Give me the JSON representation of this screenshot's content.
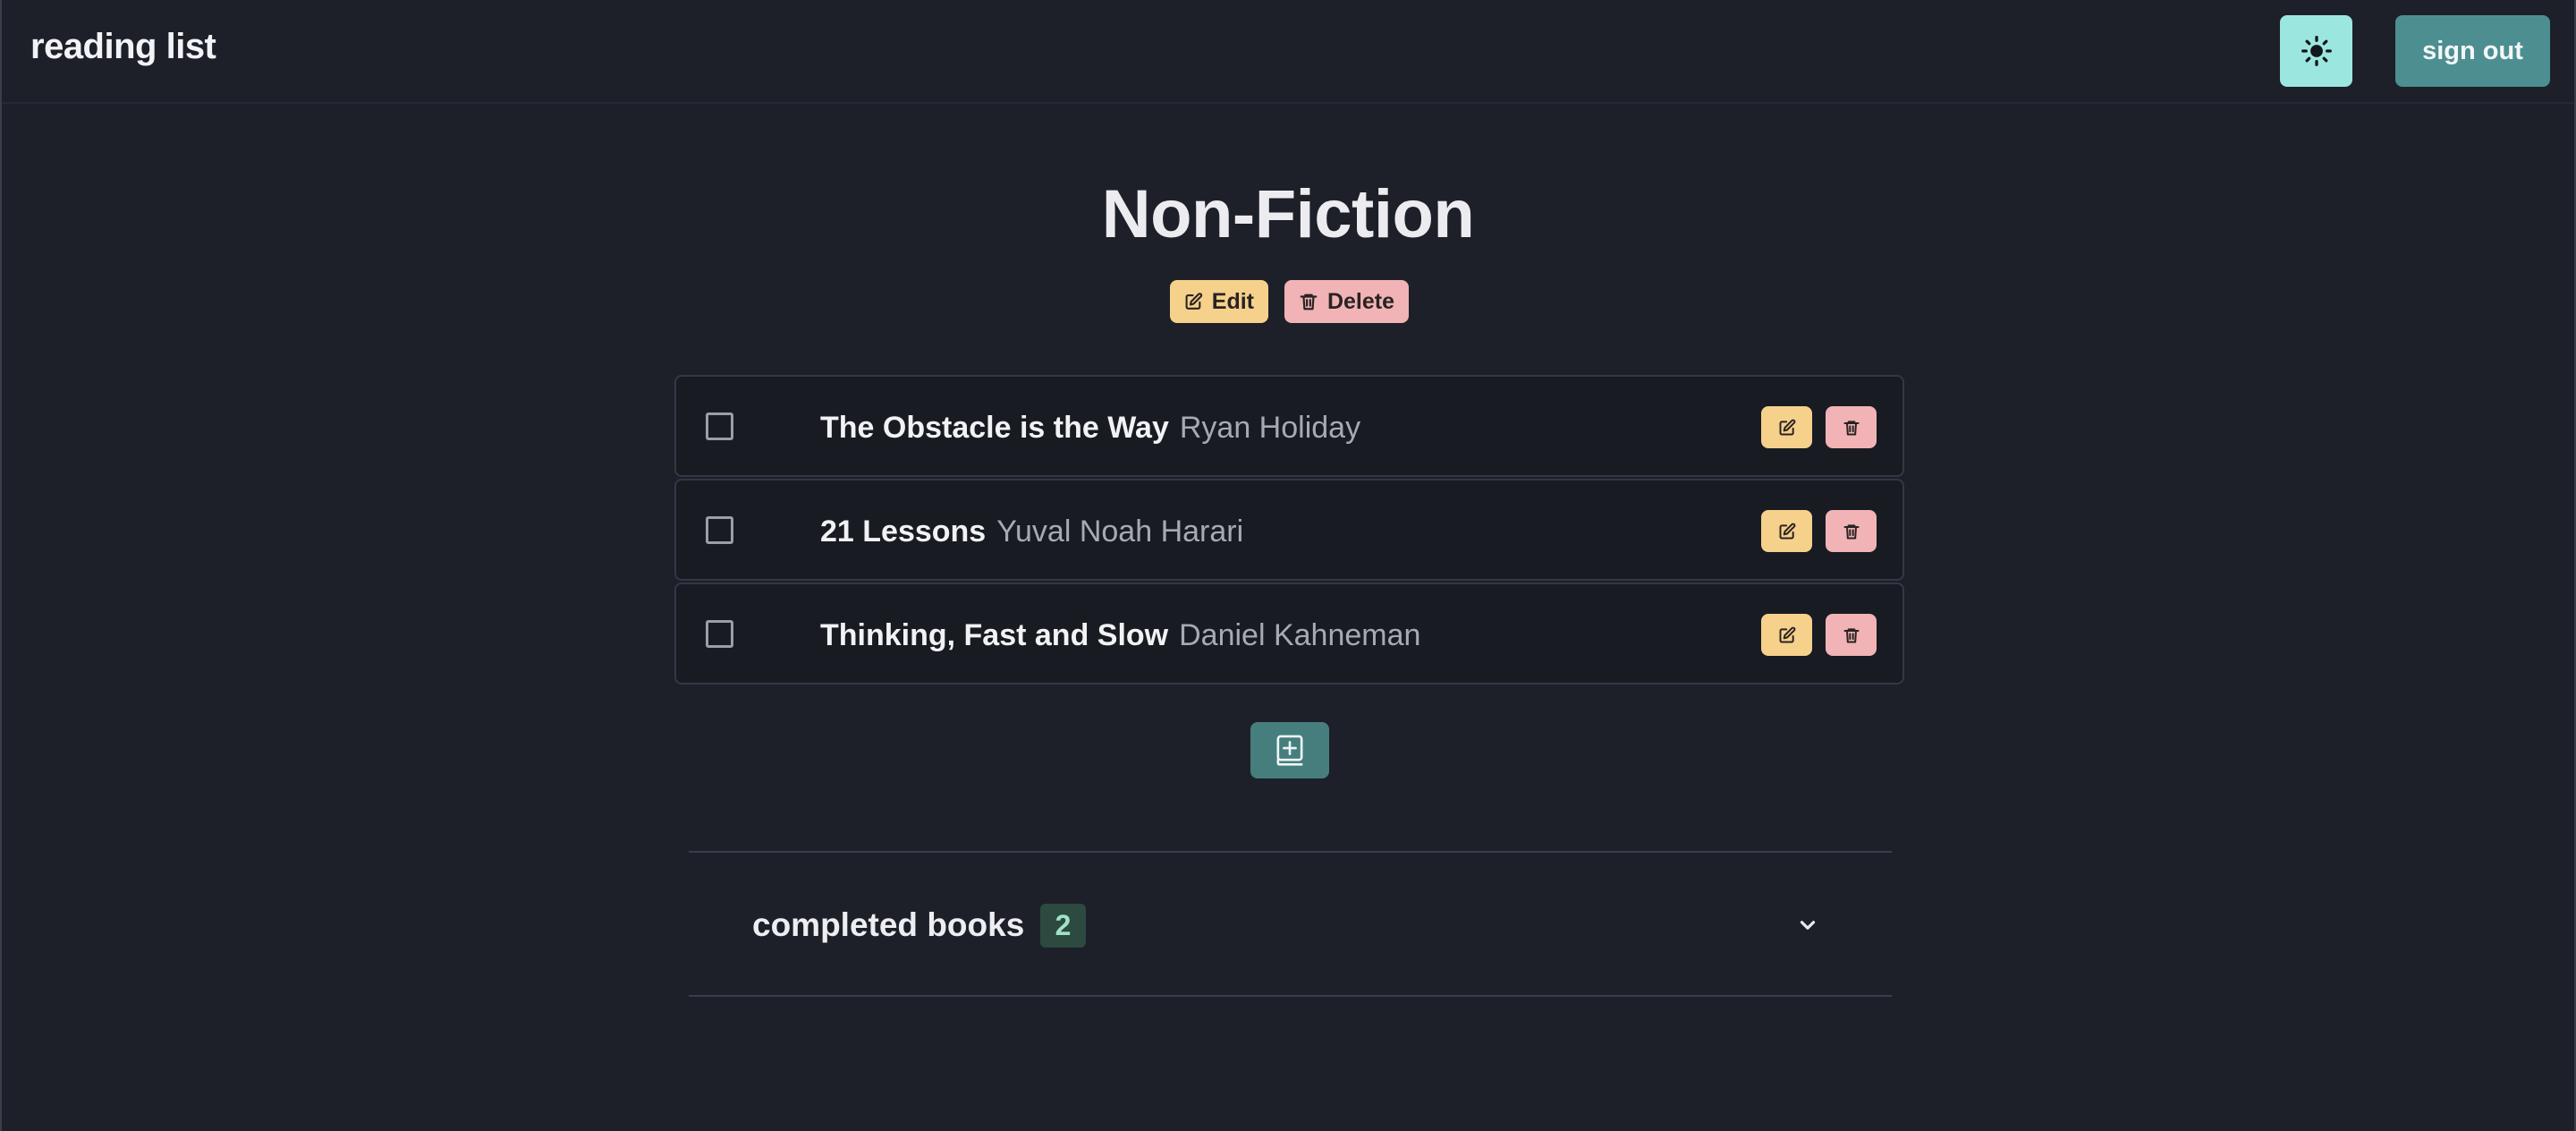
{
  "header": {
    "brand": "reading list",
    "theme_icon": "sun-icon",
    "signout_label": "sign out"
  },
  "list": {
    "title": "Non-Fiction",
    "edit_label": "Edit",
    "delete_label": "Delete"
  },
  "books": [
    {
      "title": "The Obstacle is the Way",
      "author": "Ryan Holiday",
      "checked": false
    },
    {
      "title": "21 Lessons",
      "author": "Yuval Noah Harari",
      "checked": false
    },
    {
      "title": "Thinking, Fast and Slow",
      "author": "Daniel Kahneman",
      "checked": false
    }
  ],
  "add_book_icon": "add-book-icon",
  "completed": {
    "label": "completed books",
    "count": "2",
    "icon": "chevron-down-icon"
  },
  "colors": {
    "background": "#1d2029",
    "edit": "#f6d18b",
    "delete": "#f1b3b5",
    "accent": "#4d8f90",
    "theme_button": "#9be7df"
  }
}
